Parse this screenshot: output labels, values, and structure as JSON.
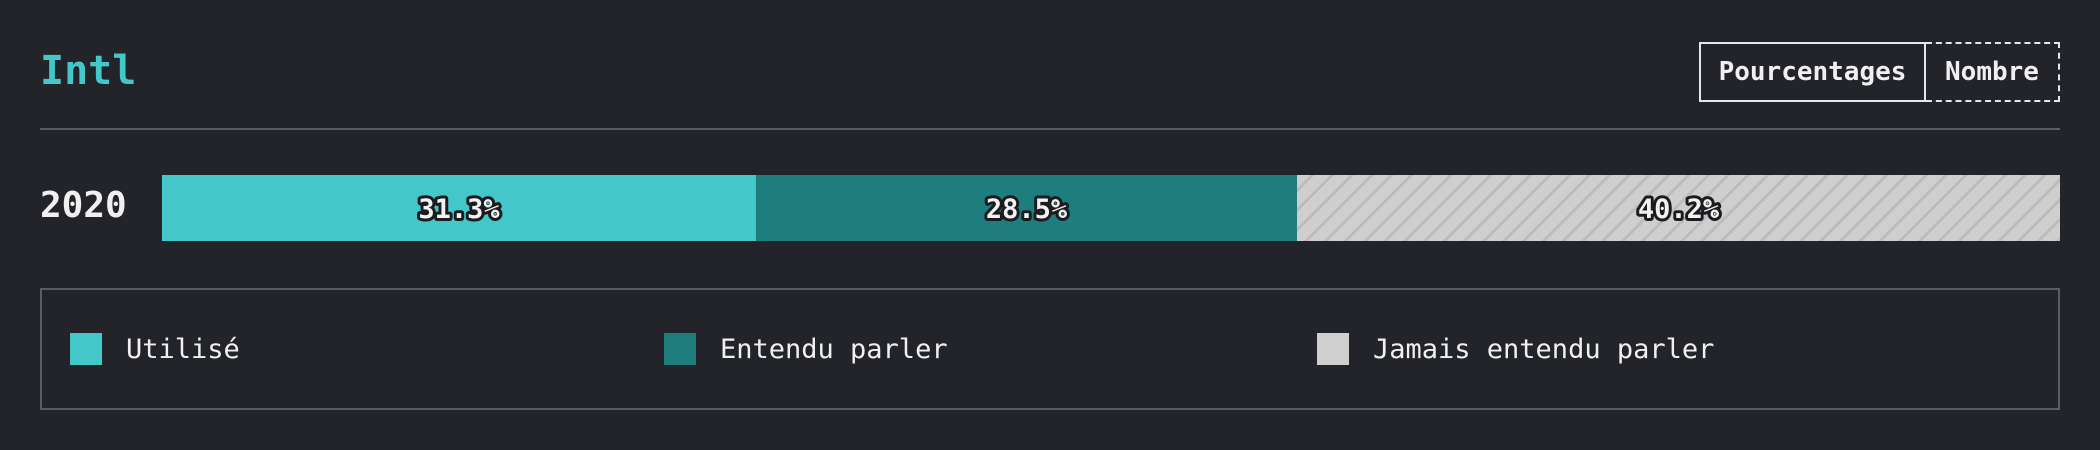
{
  "header": {
    "title": "Intl",
    "toggle": {
      "percent_label": "Pourcentages",
      "count_label": "Nombre",
      "selected": "Pourcentages"
    }
  },
  "colors": {
    "accent": "#43c7c8",
    "used": "#43c7c8",
    "heard": "#1e7e7e",
    "never": "#cfcfcf",
    "background": "#222429"
  },
  "chart_data": {
    "type": "bar",
    "orientation": "horizontal",
    "stacked": true,
    "categories": [
      "2020"
    ],
    "series": [
      {
        "name": "Utilisé",
        "values": [
          31.3
        ],
        "color": "#43c7c8",
        "label": "31.3%"
      },
      {
        "name": "Entendu parler",
        "values": [
          28.5
        ],
        "color": "#1e7e7e",
        "label": "28.5%"
      },
      {
        "name": "Jamais entendu parler",
        "values": [
          40.2
        ],
        "color": "#cfcfcf",
        "label": "40.2%",
        "pattern": "hatched"
      }
    ],
    "unit": "%",
    "xlim": [
      0,
      100
    ],
    "legend_position": "bottom"
  },
  "legend": {
    "items": [
      {
        "label": "Utilisé",
        "color": "#43c7c8"
      },
      {
        "label": "Entendu parler",
        "color": "#1e7e7e"
      },
      {
        "label": "Jamais entendu parler",
        "color": "#cfcfcf"
      }
    ]
  }
}
